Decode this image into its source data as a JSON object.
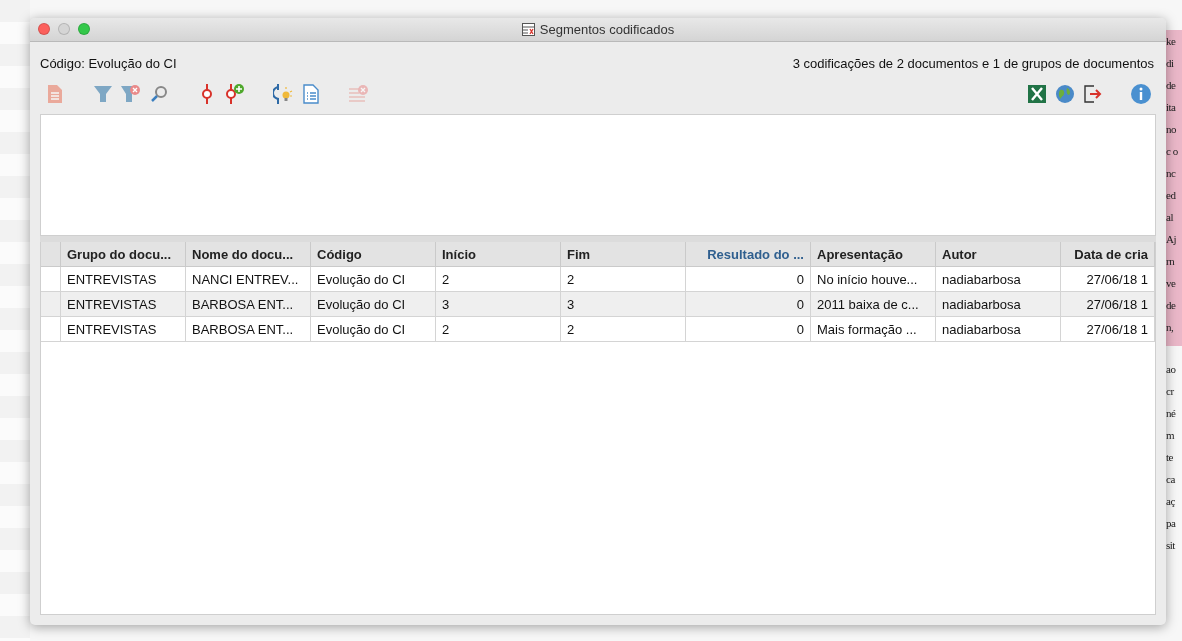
{
  "window": {
    "title": "Segmentos codificados"
  },
  "code_label": "Código: Evolução do CI",
  "summary": "3 codificações de 2 documentos e 1 de grupos de documentos",
  "toolbar_left": [
    {
      "kind": "document",
      "disabled": true
    },
    {
      "kind": "gap"
    },
    {
      "kind": "filter",
      "disabled": false
    },
    {
      "kind": "filter-clear",
      "disabled": false
    },
    {
      "kind": "search",
      "disabled": false
    },
    {
      "kind": "gap"
    },
    {
      "kind": "code-pin",
      "disabled": false
    },
    {
      "kind": "code-pin-add",
      "disabled": false
    },
    {
      "kind": "gap"
    },
    {
      "kind": "code-idea",
      "disabled": false
    },
    {
      "kind": "list-doc",
      "disabled": false
    },
    {
      "kind": "gap"
    },
    {
      "kind": "clear-list",
      "disabled": true
    }
  ],
  "toolbar_right": [
    {
      "kind": "excel"
    },
    {
      "kind": "globe"
    },
    {
      "kind": "export"
    },
    {
      "kind": "gap"
    },
    {
      "kind": "info"
    }
  ],
  "table": {
    "columns": [
      {
        "label": "Grupo do docu...",
        "sorted": false
      },
      {
        "label": "Nome do docu...",
        "sorted": false
      },
      {
        "label": "Código",
        "sorted": false
      },
      {
        "label": "Início",
        "sorted": false
      },
      {
        "label": "Fim",
        "sorted": false
      },
      {
        "label": "Resultado do ...",
        "sorted": true
      },
      {
        "label": "Apresentação",
        "sorted": false
      },
      {
        "label": "Autor",
        "sorted": false
      },
      {
        "label": "Data de cria",
        "sorted": false
      }
    ],
    "rows": [
      {
        "cells": [
          "ENTREVISTAS",
          "NANCI ENTREV...",
          "Evolução do CI",
          "2",
          "2",
          "0",
          "No início houve...",
          "nadiabarbosa",
          "27/06/18 1"
        ]
      },
      {
        "cells": [
          "ENTREVISTAS",
          "BARBOSA ENT...",
          "Evolução do CI",
          "3",
          "3",
          "0",
          "2011 baixa de c...",
          "nadiabarbosa",
          "27/06/18 1"
        ]
      },
      {
        "cells": [
          "ENTREVISTAS",
          "BARBOSA ENT...",
          "Evolução do CI",
          "2",
          "2",
          "0",
          "Mais formação ...",
          "nadiabarbosa",
          "27/06/18 1"
        ]
      }
    ]
  },
  "background_text": [
    "ke",
    "di",
    "de",
    "ita",
    "no",
    "c o",
    "nc",
    "ed",
    "al",
    "Aj",
    "rn",
    "ve",
    "de",
    "n,",
    "ao",
    "cr",
    "né",
    "m",
    "te",
    "ca",
    "aç",
    "pa",
    "sit"
  ]
}
